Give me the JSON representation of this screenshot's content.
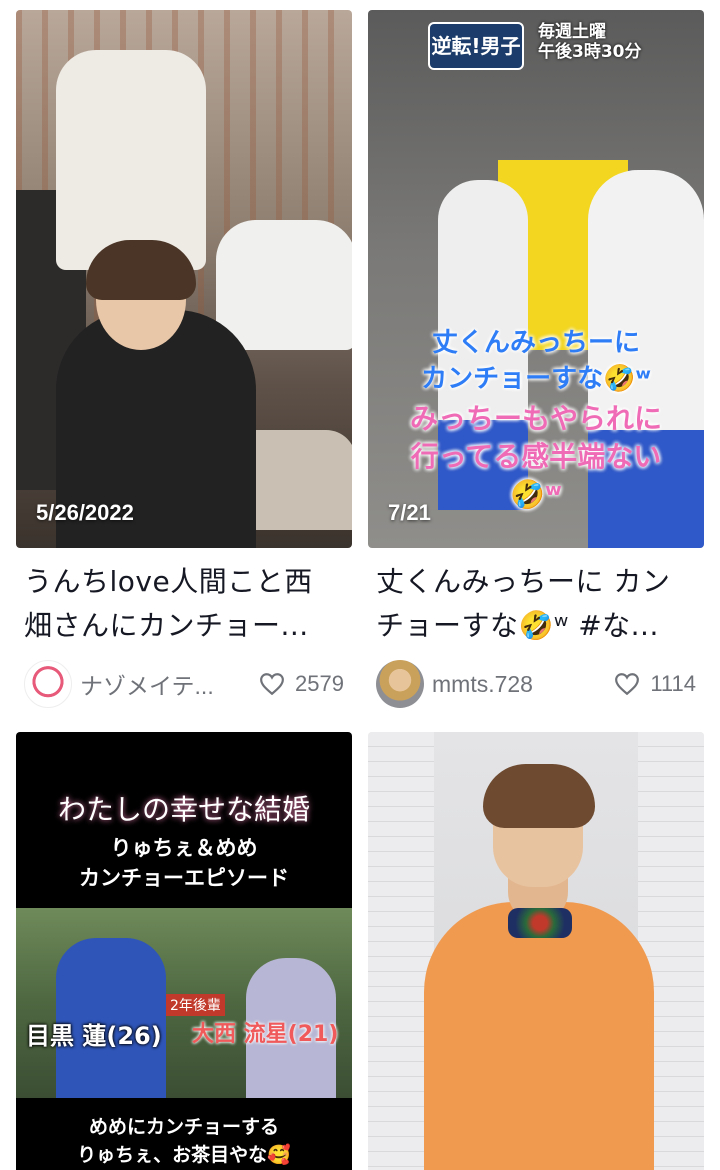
{
  "cards": [
    {
      "date": "5/26/2022",
      "caption_line1": "うんちlove人間こと西",
      "caption_line2": "畑さんにカンチョー...",
      "author": "ナゾメイテ...",
      "likes": "2579"
    },
    {
      "date": "7/21",
      "caption_line1": "丈くんみっちーに カン",
      "caption_line2": "チョーすな🤣ʷ #な...",
      "author": "mmts.728",
      "likes": "1114",
      "overlay": {
        "logo": "逆転!男子",
        "logo_sub_line1": "毎週土曜",
        "logo_sub_line2": "午後3時30分",
        "line1": "丈くんみっちーに",
        "line2": "カンチョーすな🤣ʷ",
        "line3": "みっちーもやられに",
        "line4": "行ってる感半端ない",
        "line5": "🤣ʷ"
      }
    },
    {
      "overlay": {
        "title": "わたしの幸せな結婚",
        "sub1": "りゅちぇ＆めめ",
        "sub2": "カンチョーエピソード",
        "name1": "目黒 蓮(26)",
        "name2": "大西 流星(21)",
        "tag": "2年後輩",
        "bottom1": "めめにカンチョーする",
        "bottom2": "りゅちぇ、お茶目やな🥰"
      }
    },
    {}
  ]
}
